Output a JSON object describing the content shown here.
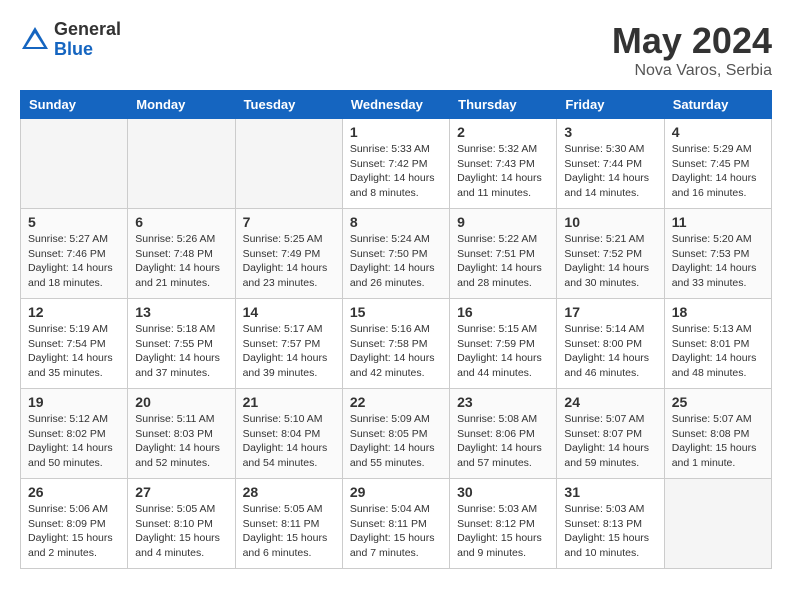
{
  "header": {
    "logo_general": "General",
    "logo_blue": "Blue",
    "month_year": "May 2024",
    "location": "Nova Varos, Serbia"
  },
  "weekdays": [
    "Sunday",
    "Monday",
    "Tuesday",
    "Wednesday",
    "Thursday",
    "Friday",
    "Saturday"
  ],
  "weeks": [
    [
      {
        "day": "",
        "info": ""
      },
      {
        "day": "",
        "info": ""
      },
      {
        "day": "",
        "info": ""
      },
      {
        "day": "1",
        "info": "Sunrise: 5:33 AM\nSunset: 7:42 PM\nDaylight: 14 hours\nand 8 minutes."
      },
      {
        "day": "2",
        "info": "Sunrise: 5:32 AM\nSunset: 7:43 PM\nDaylight: 14 hours\nand 11 minutes."
      },
      {
        "day": "3",
        "info": "Sunrise: 5:30 AM\nSunset: 7:44 PM\nDaylight: 14 hours\nand 14 minutes."
      },
      {
        "day": "4",
        "info": "Sunrise: 5:29 AM\nSunset: 7:45 PM\nDaylight: 14 hours\nand 16 minutes."
      }
    ],
    [
      {
        "day": "5",
        "info": "Sunrise: 5:27 AM\nSunset: 7:46 PM\nDaylight: 14 hours\nand 18 minutes."
      },
      {
        "day": "6",
        "info": "Sunrise: 5:26 AM\nSunset: 7:48 PM\nDaylight: 14 hours\nand 21 minutes."
      },
      {
        "day": "7",
        "info": "Sunrise: 5:25 AM\nSunset: 7:49 PM\nDaylight: 14 hours\nand 23 minutes."
      },
      {
        "day": "8",
        "info": "Sunrise: 5:24 AM\nSunset: 7:50 PM\nDaylight: 14 hours\nand 26 minutes."
      },
      {
        "day": "9",
        "info": "Sunrise: 5:22 AM\nSunset: 7:51 PM\nDaylight: 14 hours\nand 28 minutes."
      },
      {
        "day": "10",
        "info": "Sunrise: 5:21 AM\nSunset: 7:52 PM\nDaylight: 14 hours\nand 30 minutes."
      },
      {
        "day": "11",
        "info": "Sunrise: 5:20 AM\nSunset: 7:53 PM\nDaylight: 14 hours\nand 33 minutes."
      }
    ],
    [
      {
        "day": "12",
        "info": "Sunrise: 5:19 AM\nSunset: 7:54 PM\nDaylight: 14 hours\nand 35 minutes."
      },
      {
        "day": "13",
        "info": "Sunrise: 5:18 AM\nSunset: 7:55 PM\nDaylight: 14 hours\nand 37 minutes."
      },
      {
        "day": "14",
        "info": "Sunrise: 5:17 AM\nSunset: 7:57 PM\nDaylight: 14 hours\nand 39 minutes."
      },
      {
        "day": "15",
        "info": "Sunrise: 5:16 AM\nSunset: 7:58 PM\nDaylight: 14 hours\nand 42 minutes."
      },
      {
        "day": "16",
        "info": "Sunrise: 5:15 AM\nSunset: 7:59 PM\nDaylight: 14 hours\nand 44 minutes."
      },
      {
        "day": "17",
        "info": "Sunrise: 5:14 AM\nSunset: 8:00 PM\nDaylight: 14 hours\nand 46 minutes."
      },
      {
        "day": "18",
        "info": "Sunrise: 5:13 AM\nSunset: 8:01 PM\nDaylight: 14 hours\nand 48 minutes."
      }
    ],
    [
      {
        "day": "19",
        "info": "Sunrise: 5:12 AM\nSunset: 8:02 PM\nDaylight: 14 hours\nand 50 minutes."
      },
      {
        "day": "20",
        "info": "Sunrise: 5:11 AM\nSunset: 8:03 PM\nDaylight: 14 hours\nand 52 minutes."
      },
      {
        "day": "21",
        "info": "Sunrise: 5:10 AM\nSunset: 8:04 PM\nDaylight: 14 hours\nand 54 minutes."
      },
      {
        "day": "22",
        "info": "Sunrise: 5:09 AM\nSunset: 8:05 PM\nDaylight: 14 hours\nand 55 minutes."
      },
      {
        "day": "23",
        "info": "Sunrise: 5:08 AM\nSunset: 8:06 PM\nDaylight: 14 hours\nand 57 minutes."
      },
      {
        "day": "24",
        "info": "Sunrise: 5:07 AM\nSunset: 8:07 PM\nDaylight: 14 hours\nand 59 minutes."
      },
      {
        "day": "25",
        "info": "Sunrise: 5:07 AM\nSunset: 8:08 PM\nDaylight: 15 hours\nand 1 minute."
      }
    ],
    [
      {
        "day": "26",
        "info": "Sunrise: 5:06 AM\nSunset: 8:09 PM\nDaylight: 15 hours\nand 2 minutes."
      },
      {
        "day": "27",
        "info": "Sunrise: 5:05 AM\nSunset: 8:10 PM\nDaylight: 15 hours\nand 4 minutes."
      },
      {
        "day": "28",
        "info": "Sunrise: 5:05 AM\nSunset: 8:11 PM\nDaylight: 15 hours\nand 6 minutes."
      },
      {
        "day": "29",
        "info": "Sunrise: 5:04 AM\nSunset: 8:11 PM\nDaylight: 15 hours\nand 7 minutes."
      },
      {
        "day": "30",
        "info": "Sunrise: 5:03 AM\nSunset: 8:12 PM\nDaylight: 15 hours\nand 9 minutes."
      },
      {
        "day": "31",
        "info": "Sunrise: 5:03 AM\nSunset: 8:13 PM\nDaylight: 15 hours\nand 10 minutes."
      },
      {
        "day": "",
        "info": ""
      }
    ]
  ]
}
